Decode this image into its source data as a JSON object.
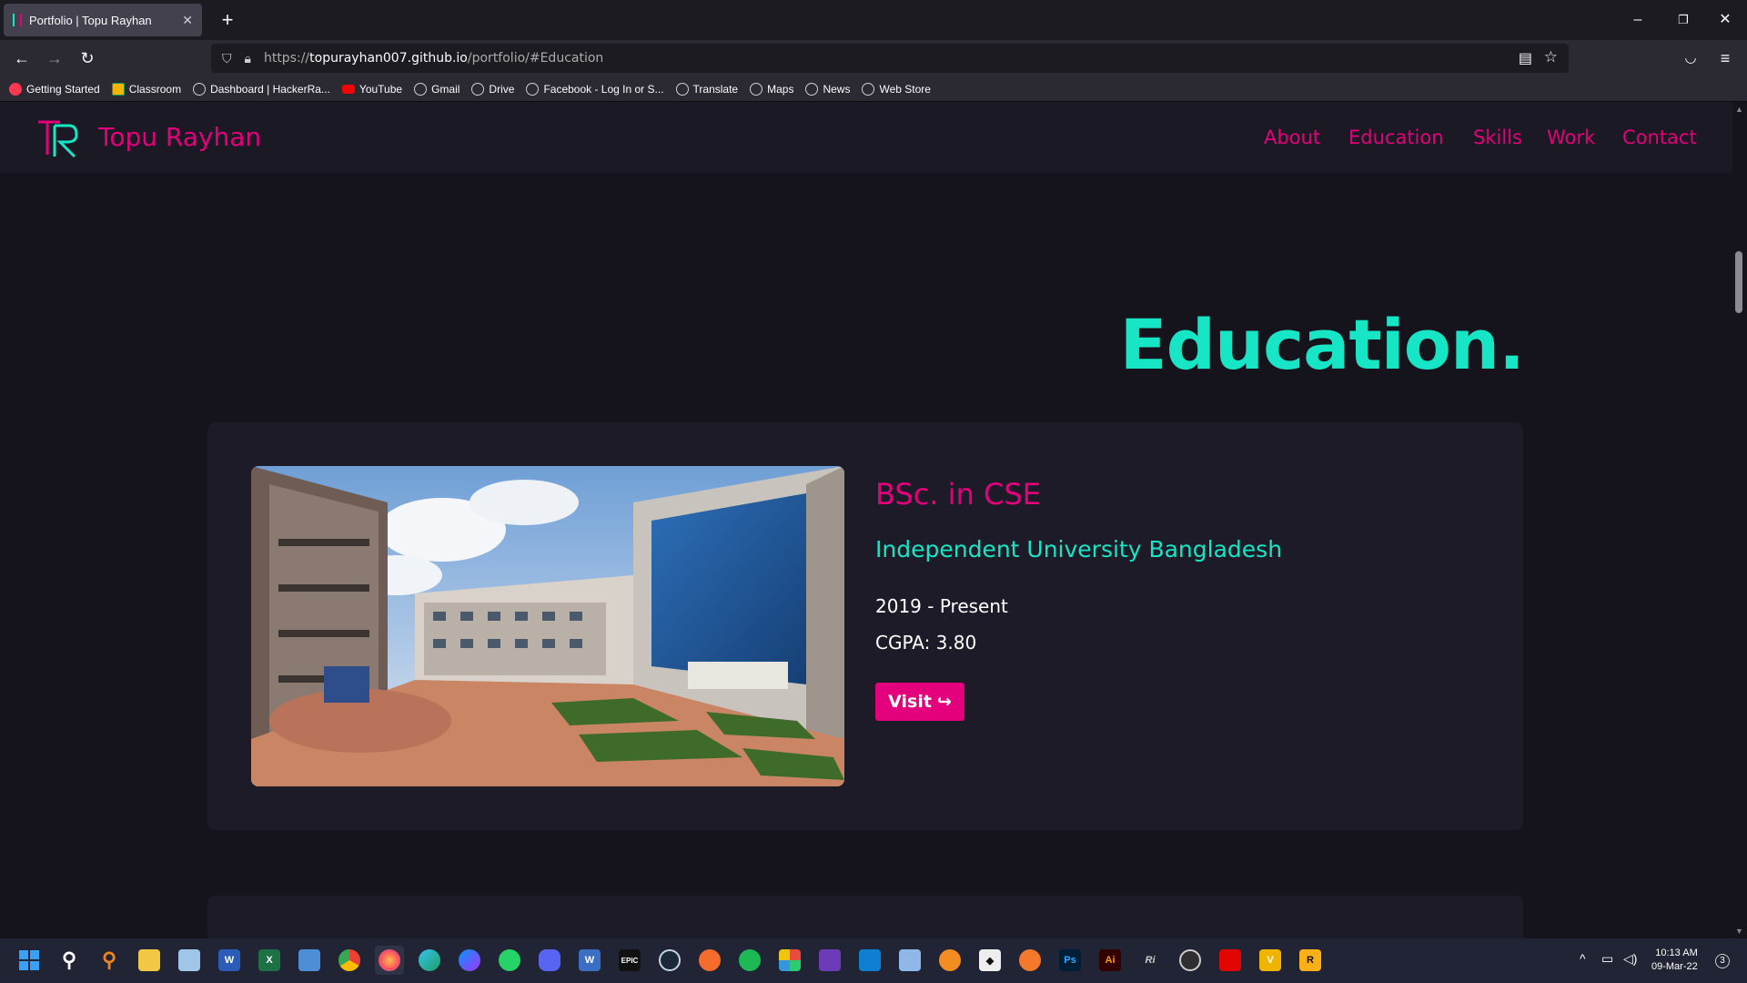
{
  "browser": {
    "tab_title": "Portfolio | Topu Rayhan",
    "tab_close": "✕",
    "new_tab": "+",
    "url_prefix": "https://",
    "url_domain": "topurayhan007.github.io",
    "url_path": "/portfolio/#Education",
    "window_controls": [
      "–",
      "❐",
      "✕"
    ]
  },
  "bookmarks": [
    {
      "label": "Getting Started",
      "icon": "firefox-icon"
    },
    {
      "label": "Classroom",
      "icon": "classroom-icon"
    },
    {
      "label": "Dashboard | HackerRa...",
      "icon": "globe-icon"
    },
    {
      "label": "YouTube",
      "icon": "youtube-icon"
    },
    {
      "label": "Gmail",
      "icon": "globe-icon"
    },
    {
      "label": "Drive",
      "icon": "globe-icon"
    },
    {
      "label": "Facebook - Log In or S...",
      "icon": "globe-icon"
    },
    {
      "label": "Translate",
      "icon": "globe-icon"
    },
    {
      "label": "Maps",
      "icon": "globe-icon"
    },
    {
      "label": "News",
      "icon": "globe-icon"
    },
    {
      "label": "Web Store",
      "icon": "globe-icon"
    }
  ],
  "site": {
    "brand": "Topu Rayhan",
    "nav": [
      "About",
      "Education",
      "Skills",
      "Work",
      "Contact"
    ],
    "section_title": "Education.",
    "education": {
      "degree": "BSc. in CSE",
      "institution": "Independent University Bangladesh",
      "years": "2019 - Present",
      "cgpa": "CGPA: 3.80",
      "visit_label": "Visit"
    }
  },
  "taskbar": {
    "time": "10:13 AM",
    "date": "09-Mar-22",
    "notifications": "3"
  },
  "colors": {
    "accent_pink": "#e4007c",
    "accent_teal": "#16e6c6",
    "page_bg": "#15131c",
    "card_bg": "#1e1b28"
  }
}
